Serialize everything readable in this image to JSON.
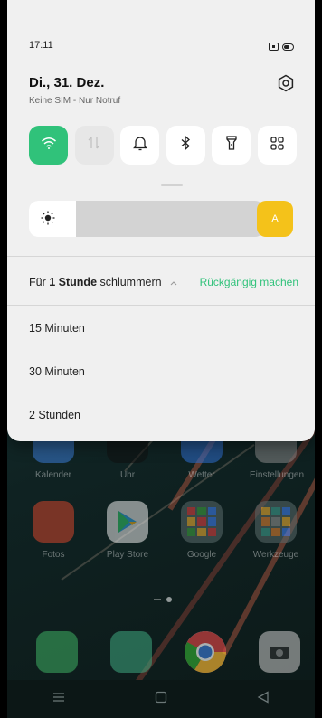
{
  "status_bar": {
    "time": "17:11"
  },
  "header": {
    "date": "Di., 31. Dez.",
    "sim_status": "Keine SIM - Nur Notruf"
  },
  "quick_tiles": [
    {
      "name": "wifi",
      "active": true
    },
    {
      "name": "mobile-data",
      "active": false
    },
    {
      "name": "sound",
      "active": true
    },
    {
      "name": "bluetooth",
      "active": true
    },
    {
      "name": "flashlight",
      "active": true
    },
    {
      "name": "more",
      "active": true
    }
  ],
  "brightness": {
    "level": 0.2,
    "auto_label": "A"
  },
  "snooze": {
    "prefix": "Für ",
    "duration": "1 Stunde",
    "suffix": " schlummern",
    "undo_label": "Rückgängig machen",
    "options": [
      "15 Minuten",
      "30 Minuten",
      "2 Stunden"
    ]
  },
  "home_screen": {
    "row1": [
      "Kalender",
      "Uhr",
      "Wetter",
      "Einstellungen"
    ],
    "row2": [
      "Fotos",
      "Play Store",
      "Google",
      "Werkzeuge"
    ]
  },
  "colors": {
    "accent": "#30c27a",
    "auto_brightness": "#f4c21a"
  }
}
